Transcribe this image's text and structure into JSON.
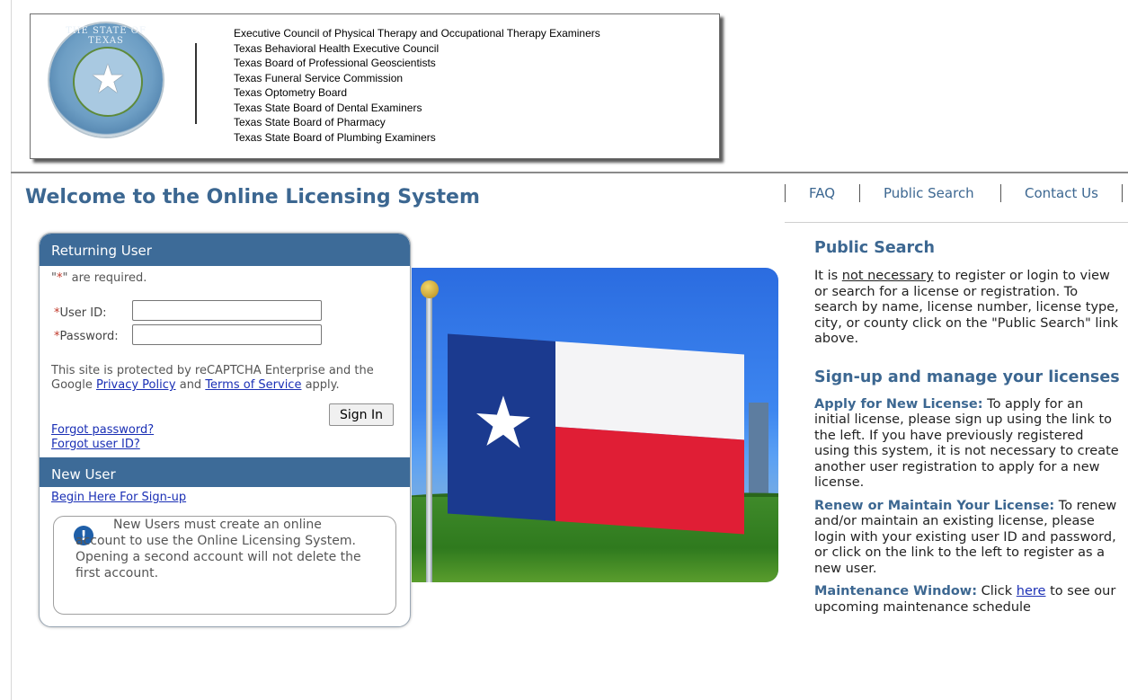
{
  "header": {
    "agencies": [
      "Executive Council of Physical Therapy and Occupational Therapy Examiners",
      "Texas Behavioral Health Executive Council",
      "Texas Board of Professional Geoscientists",
      "Texas Funeral Service Commission",
      "Texas Optometry Board",
      "Texas State Board of Dental Examiners",
      "Texas State Board of Pharmacy",
      "Texas State Board of Plumbing Examiners"
    ],
    "seal_text": "THE STATE OF TEXAS",
    "seal_icon": "star-icon"
  },
  "page_title": "Welcome to the Online Licensing System",
  "topnav": {
    "faq": "FAQ",
    "public_search": "Public Search",
    "contact_us": "Contact Us"
  },
  "login": {
    "returning_user_title": "Returning User",
    "required_note_prefix": "\"",
    "required_note_star": "*",
    "required_note_suffix": "\" are required.",
    "user_id_label": "User ID:",
    "password_label": "Password:",
    "required_marker": "*",
    "user_id_value": "",
    "password_value": "",
    "recaptcha_prefix": "This site is protected by reCAPTCHA Enterprise and the Google ",
    "privacy_policy": "Privacy Policy",
    "recaptcha_and": " and ",
    "terms_of_service": "Terms of Service",
    "recaptcha_suffix": " apply.",
    "sign_in": "Sign In",
    "forgot_password": "Forgot password?",
    "forgot_user_id": "Forgot user ID?"
  },
  "new_user": {
    "title": "New User",
    "begin_signup": "Begin Here For Sign-up",
    "notice": "New Users must create an online account to use the Online Licensing System. Opening a second account will not delete the first account.",
    "notice_icon": "info-icon"
  },
  "right_column": {
    "public_search_heading": "Public Search",
    "public_search_pre": "It is ",
    "public_search_emph": "not necessary",
    "public_search_post": " to register or login to view or search for a license or registration. To search by name, license number, license type, city, or county click on the \"Public Search\" link above.",
    "signup_heading": "Sign-up and manage your licenses",
    "apply_lead": "Apply for New License:",
    "apply_text": " To apply for an initial license, please sign up using the link to the left. If you have previously registered using this system, it is not necessary to create another user registration to apply for a new license.",
    "renew_lead": "Renew or Maintain Your License:",
    "renew_text": " To renew and/or maintain an existing license, please login with your existing user ID and password, or click on the link to the left to register as a new user.",
    "maint_lead": "Maintenance Window:",
    "maint_pre": " Click ",
    "maint_link": "here",
    "maint_post": " to see our upcoming maintenance schedule"
  },
  "colors": {
    "accent": "#3c6791",
    "panel_header": "#3d6b98",
    "link": "#1a2fb5",
    "required": "#c0392b"
  }
}
